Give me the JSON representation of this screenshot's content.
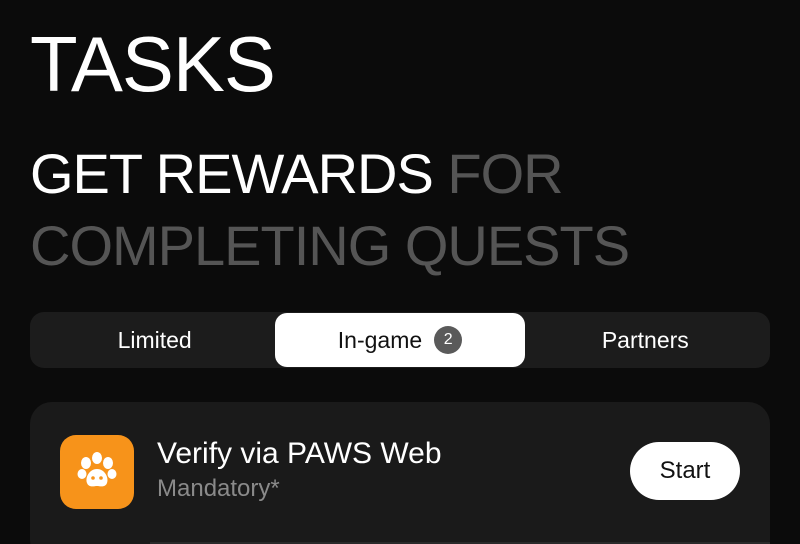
{
  "header": {
    "title": "TASKS",
    "headline_bright": "GET REWARDS",
    "headline_dim_1": "FOR",
    "headline_dim_2": "COMPLETING QUESTS"
  },
  "tabs": [
    {
      "label": "Limited",
      "active": false
    },
    {
      "label": "In-game",
      "active": true,
      "badge": "2"
    },
    {
      "label": "Partners",
      "active": false
    }
  ],
  "tasks": [
    {
      "icon": "paw-icon",
      "title": "Verify via PAWS Web",
      "subtitle": "Mandatory*",
      "action_label": "Start"
    }
  ],
  "colors": {
    "background": "#0b0b0b",
    "tab_bar": "#1c1c1c",
    "card": "#1a1a1a",
    "accent_orange": "#f7931a",
    "dim_text": "#555555",
    "subtitle_text": "#8a8a8a"
  }
}
